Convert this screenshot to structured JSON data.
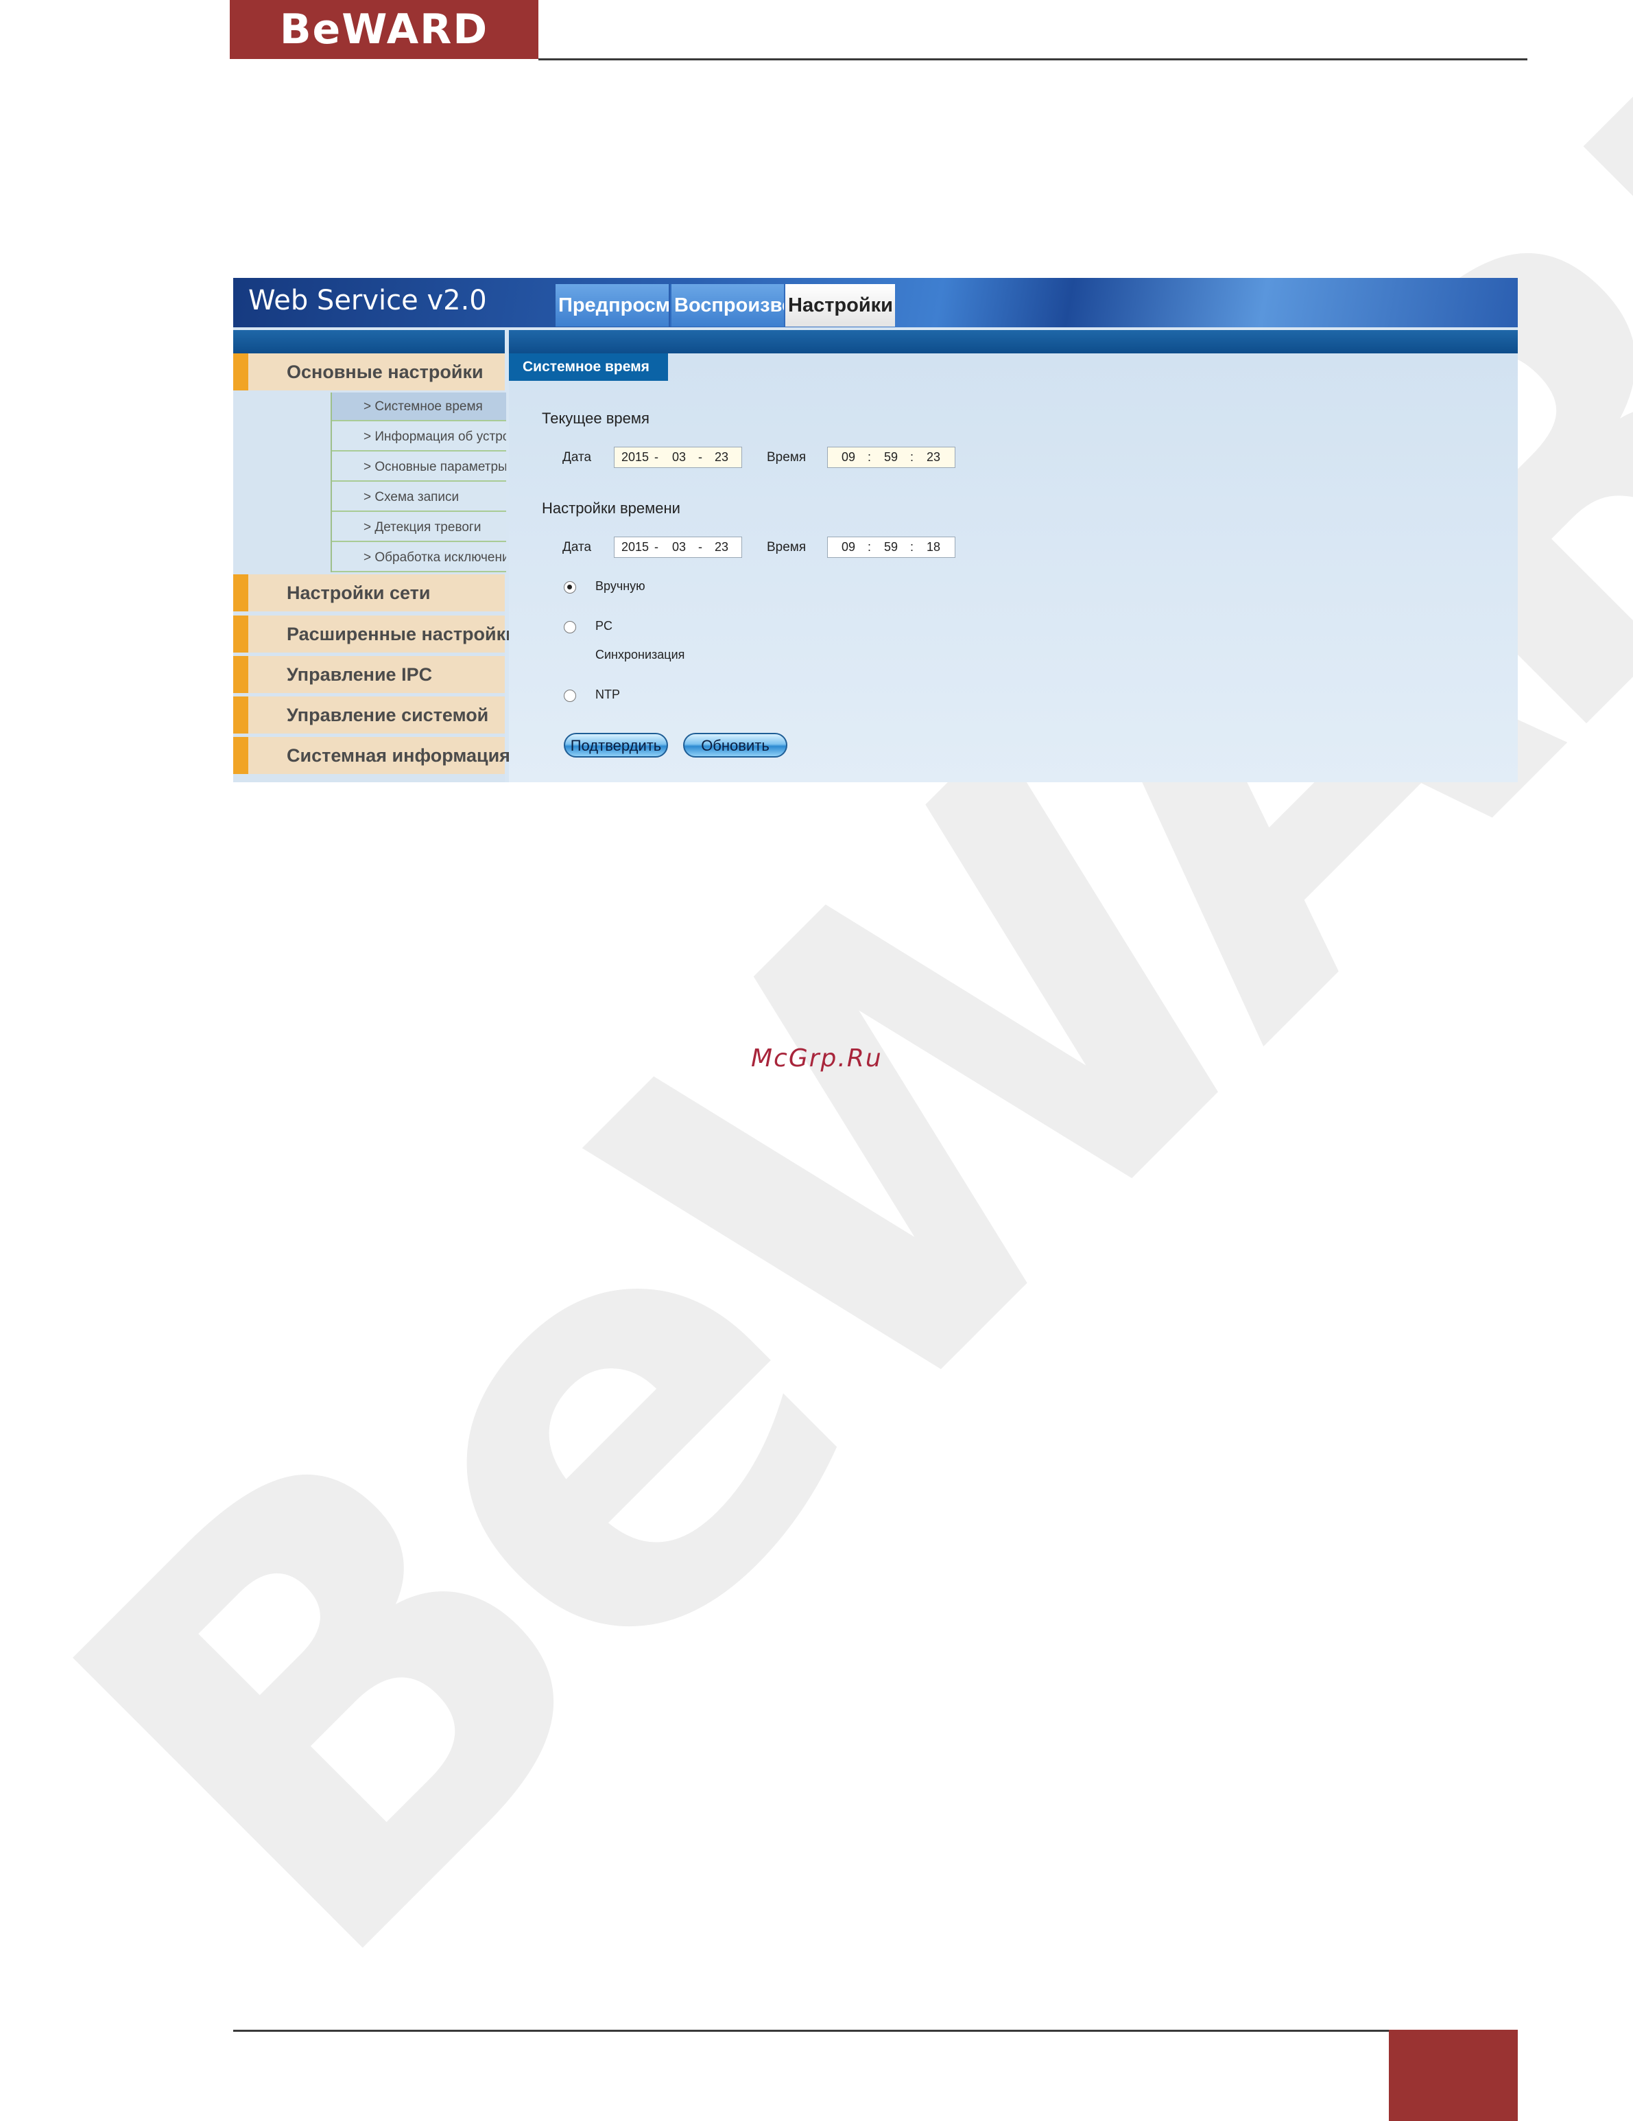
{
  "doc": {
    "brand": "BeWARD",
    "watermark": "BeWARD",
    "mcgrp": "McGrp.Ru"
  },
  "app": {
    "title": "Web Service v2.0",
    "tabs": [
      {
        "label": "Предпросмотр",
        "active": false
      },
      {
        "label": "Воспроизведение",
        "active": false
      },
      {
        "label": "Настройки",
        "active": true
      }
    ]
  },
  "sidebar": {
    "menu": [
      "Основные настройки",
      "Настройки сети",
      "Расширенные настройки",
      "Управление IPC",
      "Управление системой",
      "Системная информация"
    ],
    "submenu": [
      "> Системное время",
      "> Информация об устройстве",
      "> Основные параметры",
      "> Схема записи",
      "> Детекция тревоги",
      "> Обработка исключений"
    ]
  },
  "content": {
    "section_title": "Системное время",
    "current_time": {
      "heading": "Текущее время",
      "date_label": "Дата",
      "date": {
        "year": "2015",
        "month": "03",
        "day": "23"
      },
      "time_label": "Время",
      "time": {
        "h": "09",
        "m": "59",
        "s": "23"
      }
    },
    "time_settings": {
      "heading": "Настройки времени",
      "date_label": "Дата",
      "date": {
        "year": "2015",
        "month": "03",
        "day": "23"
      },
      "time_label": "Время",
      "time": {
        "h": "09",
        "m": "59",
        "s": "18"
      }
    },
    "sync": {
      "manual": "Вручную",
      "pc": "PC",
      "pc_sub": "Синхронизация",
      "ntp": "NTP",
      "selected": "manual"
    },
    "buttons": {
      "confirm": "Подтвердить",
      "refresh": "Обновить"
    },
    "separators": {
      "date": "-",
      "time": ":"
    }
  },
  "colors": {
    "brand": "#9a3332",
    "accent_orange": "#f1a425",
    "header_blue": "#0b63a6"
  }
}
